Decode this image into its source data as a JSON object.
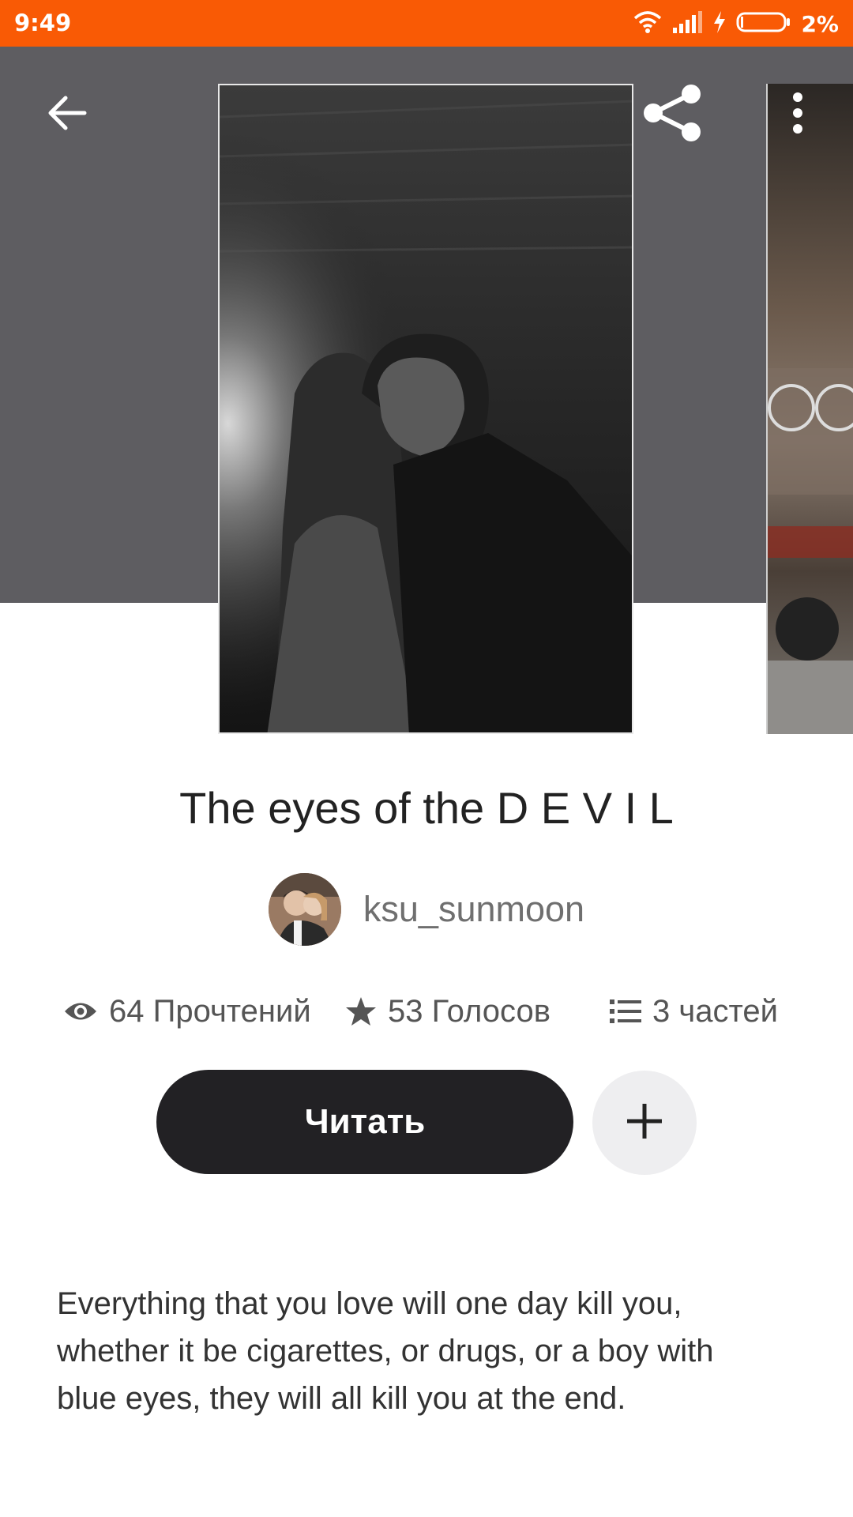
{
  "status_bar": {
    "time": "9:49",
    "battery_percent": "2%",
    "icons": [
      "wifi-icon",
      "signal-icon",
      "charging-icon",
      "battery-icon"
    ]
  },
  "header": {
    "back_icon": "arrow-left-icon",
    "share_icon": "share-icon",
    "more_icon": "more-vertical-icon",
    "background_color": "#5e5d61"
  },
  "story": {
    "title": "The eyes of the D E V I L",
    "author": "ksu_sunmoon",
    "stats": {
      "reads": "64 Прочтений",
      "votes": "53 Голосов",
      "parts": "3 частей"
    },
    "read_label": "Читать",
    "add_icon": "plus-icon",
    "description": " Everything that you love will one day kill you,\nwhether it be cigarettes, or drugs, or a boy with\nblue eyes, they will all kill you at the end."
  },
  "colors": {
    "accent": "#f95a05",
    "button_dark": "#222124",
    "add_button_bg": "#eeeef0"
  }
}
